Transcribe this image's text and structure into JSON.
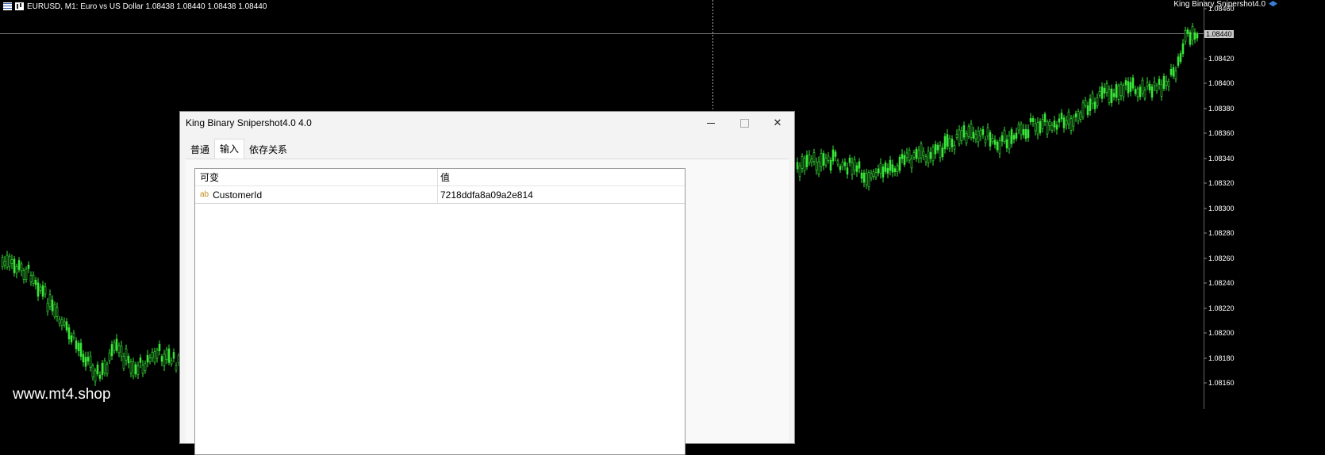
{
  "chart": {
    "symbol_label": "EURUSD, M1:  Euro vs US Dollar  1.08438 1.08440 1.08438 1.08440",
    "ea_label": "King Binary Snipershot4.0",
    "current_price": "1.08440",
    "price_axis": [
      "1.08460",
      "1.08420",
      "1.08400",
      "1.08380",
      "1.08360",
      "1.08340",
      "1.08320",
      "1.08300",
      "1.08280",
      "1.08260",
      "1.08240",
      "1.08220",
      "1.08200",
      "1.08180",
      "1.08160"
    ],
    "candle_color": "#39e639",
    "grid_color": "#000000",
    "background": "#000000"
  },
  "watermark": "www.mt4.shop",
  "dialog": {
    "title": "King Binary Snipershot4.0 4.0",
    "tabs": [
      {
        "label": "普通",
        "active": false
      },
      {
        "label": "输入",
        "active": true
      },
      {
        "label": "依存关系",
        "active": false
      }
    ],
    "table": {
      "headers": [
        "可变",
        "值"
      ],
      "rows": [
        {
          "type_icon": "ab",
          "name": "CustomerId",
          "value": "7218ddfa8a09a2e814"
        }
      ]
    }
  }
}
